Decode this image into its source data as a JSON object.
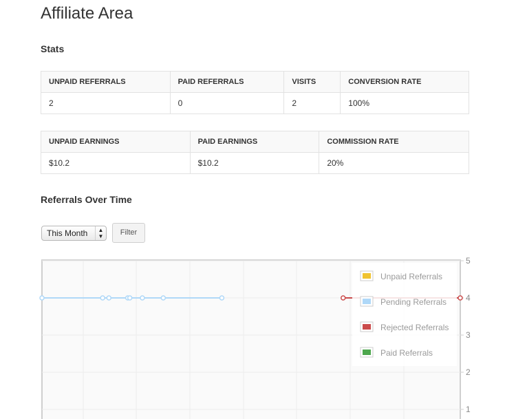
{
  "page": {
    "title": "Affiliate Area"
  },
  "stats": {
    "section_title": "Stats",
    "table1": {
      "headers": [
        "UNPAID REFERRALS",
        "PAID REFERRALS",
        "VISITS",
        "CONVERSION RATE"
      ],
      "values": [
        "2",
        "0",
        "2",
        "100%"
      ]
    },
    "table2": {
      "headers": [
        "UNPAID EARNINGS",
        "PAID EARNINGS",
        "COMMISSION RATE"
      ],
      "values": [
        "$10.2",
        "$10.2",
        "20%"
      ]
    }
  },
  "graph": {
    "section_title": "Referrals Over Time",
    "range_select": {
      "selected": "This Month"
    },
    "filter_label": "Filter"
  },
  "chart_data": {
    "type": "line",
    "y_ticks": [
      "5",
      "4",
      "3",
      "2",
      "1"
    ],
    "ylim": [
      0,
      5
    ],
    "grid": true,
    "legend_position": "top-right",
    "legend": [
      {
        "label": "Unpaid Referrals",
        "color": "#f0c330"
      },
      {
        "label": "Pending Referrals",
        "color": "#afd8f8"
      },
      {
        "label": "Rejected Referrals",
        "color": "#cb4b4b"
      },
      {
        "label": "Paid Referrals",
        "color": "#4da74d"
      }
    ],
    "series": [
      {
        "name": "Pending Referrals",
        "color": "#afd8f8",
        "x_fraction": [
          0.0,
          0.145,
          0.16,
          0.205,
          0.21,
          0.24,
          0.29,
          0.43
        ],
        "values": [
          4,
          4,
          4,
          4,
          4,
          4,
          4,
          4
        ]
      },
      {
        "name": "Rejected Referrals",
        "color": "#cb4b4b",
        "x_fraction": [
          0.72,
          1.0
        ],
        "values": [
          4,
          4
        ]
      }
    ]
  }
}
